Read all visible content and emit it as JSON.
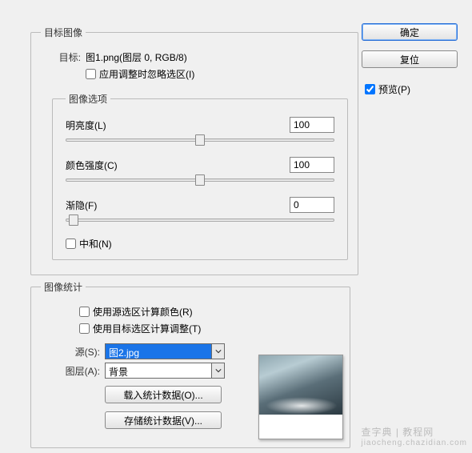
{
  "target_group": {
    "legend": "目标图像",
    "target_label": "目标:",
    "target_value": "图1.png(图层 0, RGB/8)",
    "ignore_sel_checkbox": "应用调整时忽略选区(I)",
    "ignore_sel_checked": false
  },
  "options_group": {
    "legend": "图像选项",
    "luminance": {
      "label": "明亮度(L)",
      "value": "100",
      "pos": 50
    },
    "color": {
      "label": "颜色强度(C)",
      "value": "100",
      "pos": 50
    },
    "fade": {
      "label": "渐隐(F)",
      "value": "0",
      "pos": 3
    },
    "neutralize": {
      "label": "中和(N)",
      "checked": false
    }
  },
  "stats_group": {
    "legend": "图像统计",
    "use_source_sel": "使用源选区计算颜色(R)",
    "use_target_sel": "使用目标选区计算调整(T)",
    "source_label": "源(S):",
    "source_value": "图2.jpg",
    "layer_label": "图层(A):",
    "layer_value": "背景",
    "load_btn": "载入统计数据(O)...",
    "save_btn": "存储统计数据(V)..."
  },
  "side": {
    "ok": "确定",
    "reset": "复位",
    "preview": "预览(P)",
    "preview_checked": true
  },
  "watermark": {
    "main": "查字典 | 教程网",
    "sub": "jiaocheng.chazidian.com"
  }
}
